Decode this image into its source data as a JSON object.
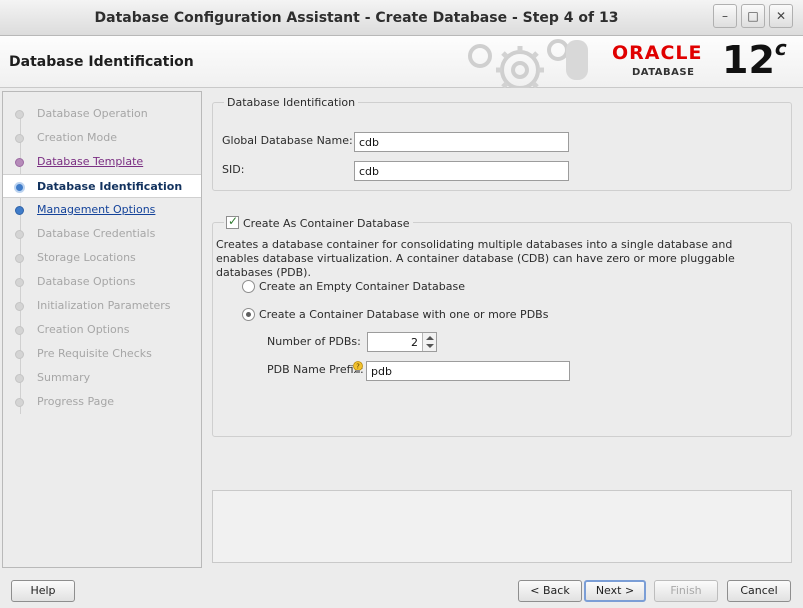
{
  "window": {
    "title": "Database Configuration Assistant - Create Database - Step 4 of 13",
    "controls": {
      "minimize": "–",
      "maximize": "□",
      "close": "✕"
    }
  },
  "header": {
    "page_title": "Database Identification",
    "brand_name": "ORACLE",
    "brand_sub": "DATABASE",
    "brand_version": "12",
    "brand_version_sup": "c",
    "brand_color": "#e00000"
  },
  "sidebar": {
    "steps": [
      {
        "label": "Database Operation",
        "state": "done"
      },
      {
        "label": "Creation Mode",
        "state": "done"
      },
      {
        "label": "Database Template",
        "state": "visited"
      },
      {
        "label": "Database Identification",
        "state": "current"
      },
      {
        "label": "Management Options",
        "state": "next"
      },
      {
        "label": "Database Credentials",
        "state": "disabled"
      },
      {
        "label": "Storage Locations",
        "state": "disabled"
      },
      {
        "label": "Database Options",
        "state": "disabled"
      },
      {
        "label": "Initialization Parameters",
        "state": "disabled"
      },
      {
        "label": "Creation Options",
        "state": "disabled"
      },
      {
        "label": "Pre Requisite Checks",
        "state": "disabled"
      },
      {
        "label": "Summary",
        "state": "disabled"
      },
      {
        "label": "Progress Page",
        "state": "disabled"
      }
    ]
  },
  "identification": {
    "group_label": "Database Identification",
    "global_name_label": "Global Database Name:",
    "global_name_value": "cdb",
    "sid_label": "SID:",
    "sid_value": "cdb"
  },
  "container": {
    "checkbox_label": "Create As Container Database",
    "checked": true,
    "description": "Creates a database container for consolidating multiple databases into a single database and enables database virtualization. A container database (CDB) can have zero or more pluggable databases (PDB).",
    "option_empty": "Create an Empty Container Database",
    "option_pdbs": "Create a Container Database with one or more PDBs",
    "selected_option": "pdbs",
    "num_pdbs_label": "Number of PDBs:",
    "num_pdbs_value": "2",
    "pdb_prefix_label": "PDB Name Prefix:",
    "pdb_prefix_value": "pdb"
  },
  "buttons": {
    "help": "Help",
    "back": "< Back",
    "next": "Next >",
    "finish": "Finish",
    "cancel": "Cancel"
  }
}
